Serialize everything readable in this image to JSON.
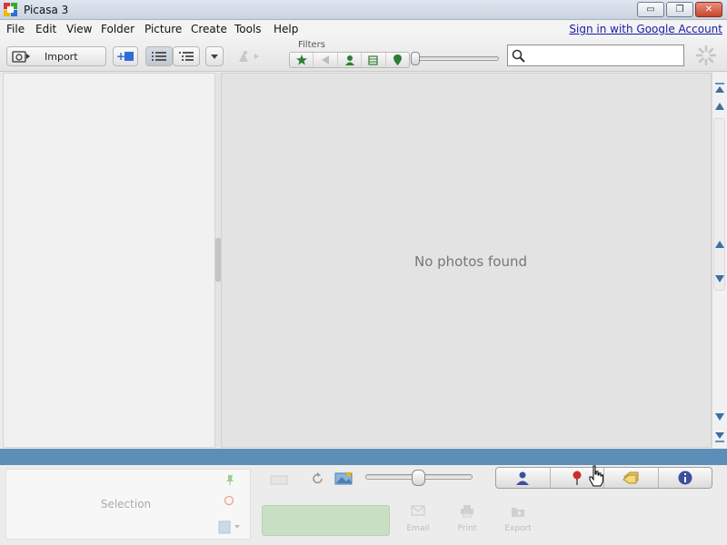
{
  "window": {
    "title": "Picasa 3",
    "minimize": "▭",
    "restore": "❐",
    "close": "✕"
  },
  "menu": {
    "items": [
      "File",
      "Edit",
      "View",
      "Folder",
      "Picture",
      "Create",
      "Tools",
      "Help"
    ],
    "sign_in": "Sign in with Google Account"
  },
  "toolbar": {
    "import_label": "Import",
    "filters_label": "Filters",
    "search_placeholder": "",
    "filter_icons": [
      "star-icon",
      "movie-icon",
      "face-icon",
      "upload-icon",
      "geotag-icon"
    ]
  },
  "main": {
    "empty_message": "No photos found"
  },
  "bottom": {
    "selection_label": "Selection",
    "actions": [
      "Email",
      "Print",
      "Export"
    ],
    "tabs": [
      "people-icon",
      "places-icon",
      "tags-icon",
      "info-icon"
    ]
  },
  "colors": {
    "tray_bar": "#5c8fb8",
    "upload_button": "#c9dfc4",
    "link": "#1a1aa6"
  }
}
